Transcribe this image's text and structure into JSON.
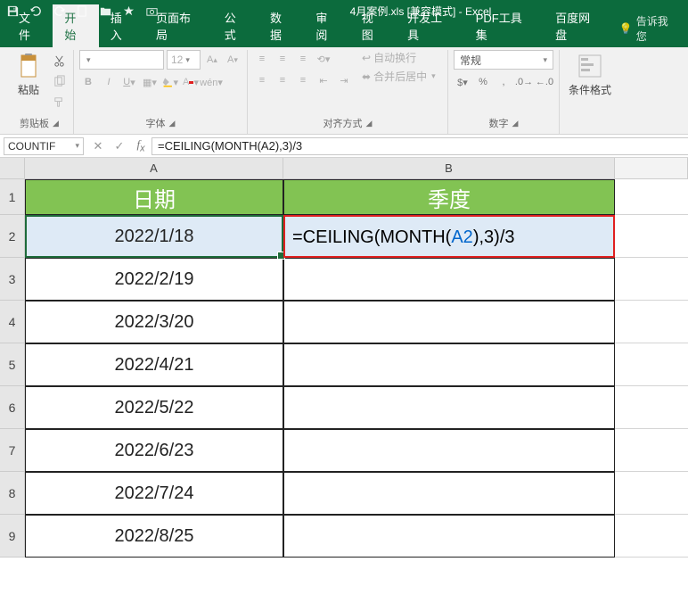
{
  "title": "4月案例.xls  [兼容模式] - Excel",
  "tabs": {
    "file": "文件",
    "home": "开始",
    "insert": "插入",
    "layout": "页面布局",
    "formulas": "公式",
    "data": "数据",
    "review": "审阅",
    "view": "视图",
    "dev": "开发工具",
    "pdf": "PDF工具集",
    "baidu": "百度网盘",
    "tellme": "告诉我您"
  },
  "ribbon": {
    "paste": "粘贴",
    "clipboard": "剪贴板",
    "font_name": "",
    "font_size": "12",
    "font_group": "字体",
    "wrap": "自动换行",
    "merge": "合并后居中",
    "align_group": "对齐方式",
    "number_format": "常规",
    "number_group": "数字",
    "cond_format": "条件格式"
  },
  "name_box": "COUNTIF",
  "formula_bar": "=CEILING(MONTH(A2),3)/3",
  "columns": {
    "A": "A",
    "B": "B"
  },
  "headers": {
    "date": "日期",
    "quarter": "季度"
  },
  "formula_parts": {
    "p1": "=CEILING(MONTH(",
    "ref": "A2",
    "p2": "),3)/3"
  },
  "rows": [
    {
      "n": "1"
    },
    {
      "n": "2",
      "a": "2022/1/18"
    },
    {
      "n": "3",
      "a": "2022/2/19"
    },
    {
      "n": "4",
      "a": "2022/3/20"
    },
    {
      "n": "5",
      "a": "2022/4/21"
    },
    {
      "n": "6",
      "a": "2022/5/22"
    },
    {
      "n": "7",
      "a": "2022/6/23"
    },
    {
      "n": "8",
      "a": "2022/7/24"
    },
    {
      "n": "9",
      "a": "2022/8/25"
    }
  ],
  "col_widths": {
    "A": 290,
    "B": 372
  },
  "row_heights": {
    "header": 40,
    "data": 48
  }
}
